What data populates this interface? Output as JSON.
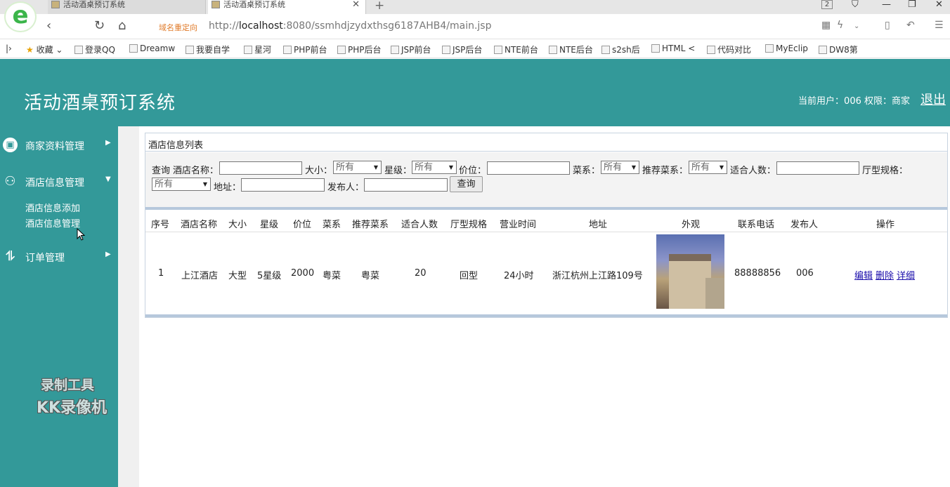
{
  "browser": {
    "tabs": [
      {
        "title": "活动酒桌预订系统",
        "active": false
      },
      {
        "title": "活动酒桌预订系统",
        "active": true
      }
    ],
    "redirect_label": "域名重定向",
    "url_prefix": "http://",
    "url_host": "localhost",
    "url_rest": ":8080/ssmhdjzydxthsg6187AHB4/main.jsp",
    "tab_count": "2",
    "bookmarks": [
      "收藏",
      "登录QQ",
      "Dreamw",
      "我要自学",
      "星河",
      "PHP前台",
      "PHP后台",
      "JSP前台",
      "JSP后台",
      "NTE前台",
      "NTE后台",
      "s2sh后",
      "HTML <",
      "代码对比",
      "MyEclip",
      "DW8第"
    ]
  },
  "app": {
    "title": "活动酒桌预订系统",
    "user_info": "当前用户：006  权限：商家",
    "logout": "退出"
  },
  "sidebar": {
    "items": [
      {
        "label": "商家资料管理",
        "arrow": "▶"
      },
      {
        "label": "酒店信息管理",
        "arrow": "▼"
      },
      {
        "label": "订单管理",
        "arrow": "▶"
      }
    ],
    "subitems": [
      "酒店信息添加",
      "酒店信息管理"
    ],
    "watermark_line1": "录制工具",
    "watermark_line2": "KK录像机"
  },
  "panel": {
    "title": "酒店信息列表",
    "search": {
      "query_label": "查询",
      "name_label": "酒店名称：",
      "size_label": "大小：",
      "size_value": "所有",
      "star_label": "星级：",
      "star_value": "所有",
      "price_label": "价位：",
      "cuisine_label": "菜系：",
      "cuisine_value": "所有",
      "recommend_label": "推荐菜系：",
      "recommend_value": "所有",
      "people_label": "适合人数：",
      "hall_label": "厅型规格：",
      "hall_value": "所有",
      "address_label": "地址：",
      "publisher_label": "发布人：",
      "button": "查询"
    },
    "table": {
      "headers": [
        "序号",
        "酒店名称",
        "大小",
        "星级",
        "价位",
        "菜系",
        "推荐菜系",
        "适合人数",
        "厅型规格",
        "营业时间",
        "地址",
        "外观",
        "联系电话",
        "发布人",
        "操作"
      ],
      "rows": [
        {
          "index": "1",
          "name": "上江酒店",
          "size": "大型",
          "star": "5星级",
          "price": "2000",
          "cuisine": "粤菜",
          "recommend": "粤菜",
          "people": "20",
          "hall": "回型",
          "hours": "24小时",
          "address": "浙江杭州上江路109号",
          "phone": "88888856",
          "publisher": "006",
          "ops": [
            "编辑",
            "删除",
            "详细"
          ]
        }
      ]
    }
  }
}
